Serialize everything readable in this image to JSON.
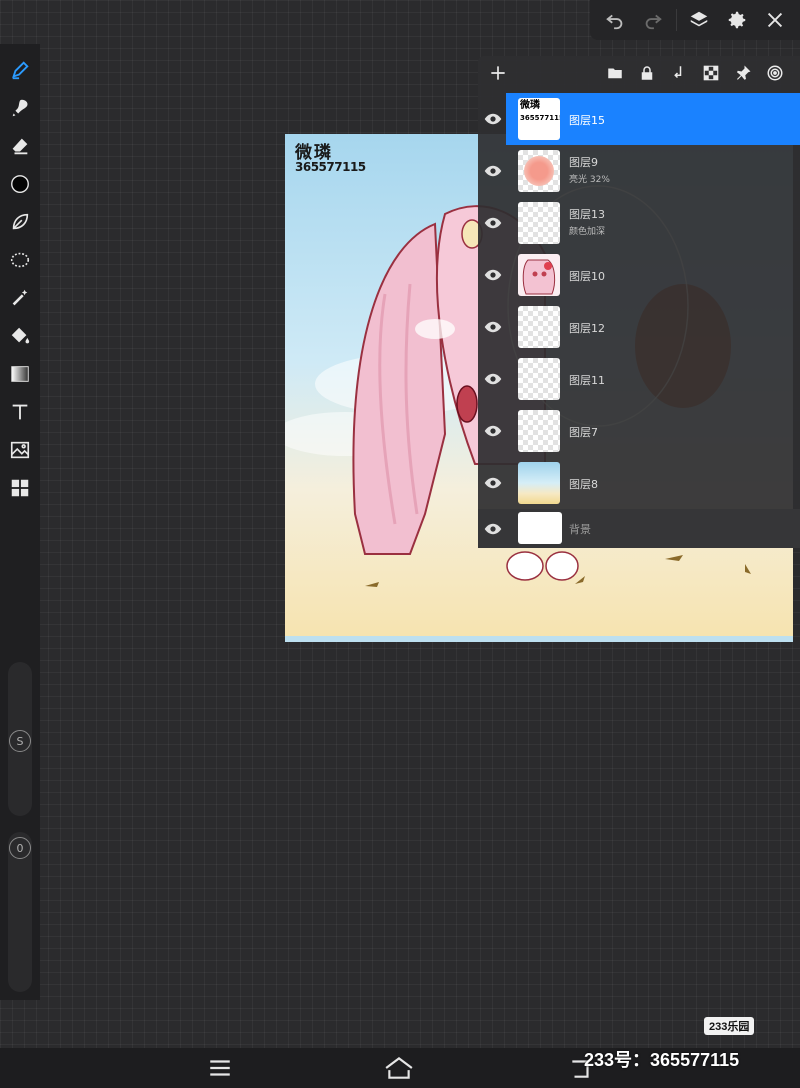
{
  "top_toolbar": {
    "items": [
      {
        "icon": "undo-icon"
      },
      {
        "icon": "redo-icon"
      },
      {
        "icon": "layers-icon"
      },
      {
        "icon": "settings-gear-icon"
      },
      {
        "icon": "close-icon"
      }
    ]
  },
  "left_toolbar": {
    "tools": [
      {
        "name": "pen-tool",
        "icon": "pen-icon",
        "active": true
      },
      {
        "name": "smudge-tool",
        "icon": "smudge-icon"
      },
      {
        "name": "eraser-tool",
        "icon": "eraser-icon"
      },
      {
        "name": "color-tool",
        "icon": "color-circle-icon"
      },
      {
        "name": "lasso-tool",
        "icon": "lasso-leaf-icon"
      },
      {
        "name": "selection-tool",
        "icon": "dotted-selection-icon"
      },
      {
        "name": "magic-wand-tool",
        "icon": "magic-wand-icon"
      },
      {
        "name": "fill-tool",
        "icon": "paint-bucket-icon"
      },
      {
        "name": "gradient-tool",
        "icon": "gradient-icon"
      },
      {
        "name": "text-tool",
        "icon": "text-icon"
      },
      {
        "name": "image-tool",
        "icon": "image-icon"
      },
      {
        "name": "filter-tool",
        "icon": "grid-icon"
      }
    ],
    "size_slider_label": "S",
    "opacity_slider_label": "0"
  },
  "artwork": {
    "signature_line1": "微璘",
    "signature_line2": "365577115"
  },
  "layers_panel": {
    "toolbar_icons": [
      "folder-icon",
      "lock-icon",
      "merge-down-icon",
      "transparency-icon",
      "pin-icon",
      "target-icon"
    ],
    "layers": [
      {
        "name": "图层15",
        "sub": "",
        "selected": true,
        "thumb": "signature"
      },
      {
        "name": "图层9",
        "sub": "亮光   32%",
        "selected": false,
        "thumb": "pink-blob"
      },
      {
        "name": "图层13",
        "sub": "颜色加深",
        "selected": false,
        "thumb": "transparent"
      },
      {
        "name": "图层10",
        "sub": "",
        "selected": false,
        "thumb": "character"
      },
      {
        "name": "图层12",
        "sub": "",
        "selected": false,
        "thumb": "transparent"
      },
      {
        "name": "图层11",
        "sub": "",
        "selected": false,
        "thumb": "transparent"
      },
      {
        "name": "图层7",
        "sub": "",
        "selected": false,
        "thumb": "transparent"
      },
      {
        "name": "图层8",
        "sub": "",
        "selected": false,
        "thumb": "sky"
      },
      {
        "name": "背景",
        "sub": "",
        "selected": false,
        "thumb": "white"
      }
    ]
  },
  "watermark": {
    "badge": "233乐园",
    "text": "233号：365577115"
  },
  "colors": {
    "accent": "#1a82ff",
    "panel": "#2e2e30",
    "toolbar": "#1f1f21"
  }
}
